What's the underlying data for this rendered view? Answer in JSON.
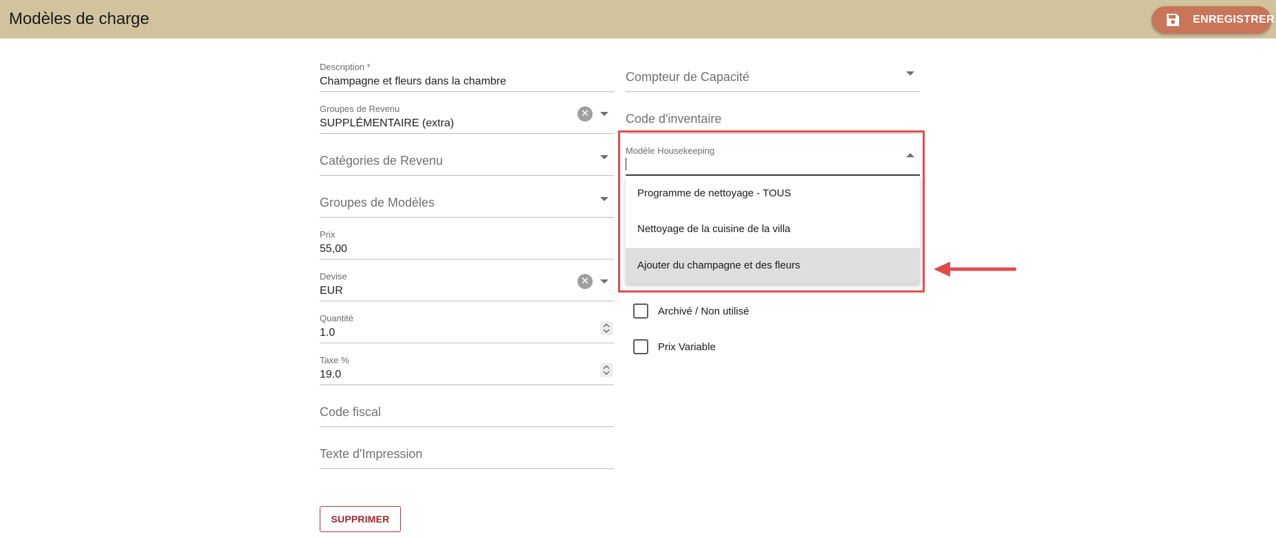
{
  "header": {
    "title": "Modèles de charge",
    "save_label": "ENREGISTRER"
  },
  "left_fields": {
    "description": {
      "label": "Description *",
      "value": "Champagne et fleurs dans la chambre"
    },
    "revenue_groups": {
      "label": "Groupes de Revenu",
      "value": "SUPPLÉMENTAIRE (extra)"
    },
    "revenue_categories": {
      "label": "Catégories de Revenu"
    },
    "template_groups": {
      "label": "Groupes de Modèles"
    },
    "price": {
      "label": "Prix",
      "value": "55,00"
    },
    "currency": {
      "label": "Devise",
      "value": "EUR"
    },
    "quantity": {
      "label": "Quantité",
      "value": "1.0"
    },
    "tax": {
      "label": "Taxe %",
      "value": "19.0"
    },
    "tax_code": {
      "label": "Code fiscal"
    },
    "print_text": {
      "label": "Texte d'Impression"
    }
  },
  "right_fields": {
    "capacity_counter": {
      "label": "Compteur de Capacité"
    },
    "inventory_code": {
      "label": "Code d'inventaire"
    },
    "housekeeping_template": {
      "label": "Modèle Housekeeping",
      "value": ""
    }
  },
  "dropdown": {
    "options": [
      "Programme de nettoyage - TOUS",
      "Nettoyage de la cuisine de la villa",
      "Ajouter du champagne et des fleurs"
    ],
    "active_index": 2
  },
  "checkboxes": {
    "archived": {
      "label": "Archivé / Non utilisé",
      "checked": false
    },
    "variable_price": {
      "label": "Prix Variable",
      "checked": false
    }
  },
  "actions": {
    "delete_label": "SUPPRIMER"
  },
  "colors": {
    "header_bg": "#d1c39d",
    "save_button": "#c9755a",
    "highlight": "#e34a4a",
    "delete_text": "#a02727"
  }
}
